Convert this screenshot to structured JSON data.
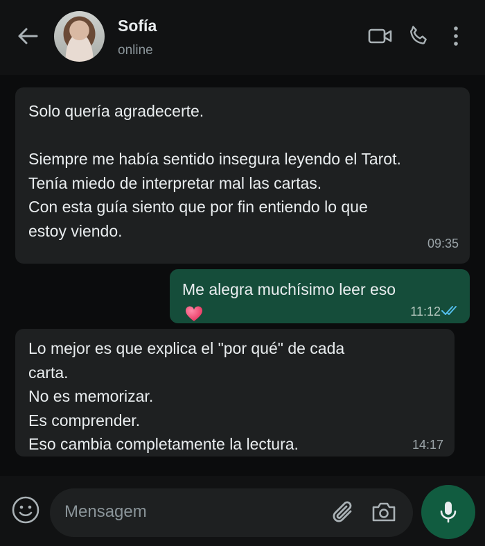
{
  "header": {
    "contact_name": "Sofía",
    "status": "online",
    "icons": [
      "back-arrow-icon",
      "video-call-icon",
      "phone-call-icon",
      "more-menu-icon"
    ]
  },
  "messages": [
    {
      "direction": "incoming",
      "lines": [
        "Solo quería agradecerte.",
        "",
        "Siempre me había sentido insegura leyendo el Tarot.",
        "Tenía miedo de interpretar mal las cartas.",
        "Con esta guía siento que por fin entiendo lo que",
        "estoy viendo."
      ],
      "time": "09:35"
    },
    {
      "direction": "outgoing",
      "lines": [
        "Me alegra muchísimo leer eso"
      ],
      "emoji": "heart",
      "time": "11:12",
      "read": true
    },
    {
      "direction": "incoming",
      "lines": [
        "Lo mejor es que explica el \"por qué\" de cada",
        "carta.",
        "No es memorizar.",
        "Es comprender.",
        "Eso cambia completamente la lectura."
      ],
      "time": "14:17"
    }
  ],
  "composer": {
    "placeholder": "Mensagem"
  },
  "colors": {
    "background": "#0b0c0d",
    "incoming_bubble": "#1e2021",
    "outgoing_bubble": "#154d3a",
    "accent": "#115c40",
    "read_ticks": "#53bdeb"
  }
}
